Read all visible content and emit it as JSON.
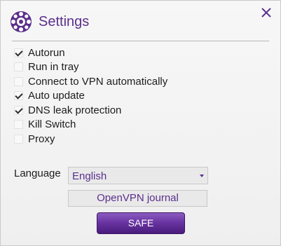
{
  "window": {
    "title": "Settings"
  },
  "options": [
    {
      "label": "Autorun",
      "checked": true
    },
    {
      "label": "Run in tray",
      "checked": false
    },
    {
      "label": "Connect to VPN automatically",
      "checked": false
    },
    {
      "label": "Auto update",
      "checked": true
    },
    {
      "label": "DNS leak protection",
      "checked": true
    },
    {
      "label": "Kill Switch",
      "checked": false
    },
    {
      "label": "Proxy",
      "checked": false
    }
  ],
  "language": {
    "label": "Language",
    "selected": "English"
  },
  "journal_button": "OpenVPN journal",
  "safe_button": "SAFE",
  "colors": {
    "accent": "#5a2f8c",
    "button": "#6a35a3"
  }
}
